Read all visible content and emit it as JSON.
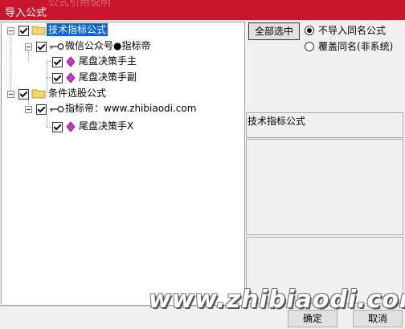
{
  "window": {
    "title": "导入公式",
    "title_shadow_text": "公式引用说明"
  },
  "tree": {
    "nodes": [
      {
        "label": "技术指标公式",
        "checked": true,
        "selected": true
      },
      {
        "label": "微信公众号●指标帝",
        "checked": true
      },
      {
        "label": "尾盘决策手主",
        "checked": true
      },
      {
        "label": "尾盘决策手副",
        "checked": true
      },
      {
        "label": "条件选股公式",
        "checked": true
      },
      {
        "label": "指标帝：www.zhibiaodi.com",
        "checked": true
      },
      {
        "label": "尾盘决策手X",
        "checked": true
      }
    ]
  },
  "options": {
    "select_all_label": "全部选中",
    "radio_no_import_label": "不导入同名公式",
    "radio_overwrite_label": "覆盖同名(非系统)",
    "selected_option": "不导入同名公式"
  },
  "detail": {
    "header": "技术指标公式"
  },
  "footer": {
    "ok_label": "确定",
    "cancel_label": "取消"
  },
  "watermark": {
    "text": "www.zhibiaodi.com"
  },
  "colors": {
    "titlebar": "#c8162b",
    "selection": "#0a64d6",
    "gem": "#cc33cc",
    "folder": "#f5d66a"
  }
}
